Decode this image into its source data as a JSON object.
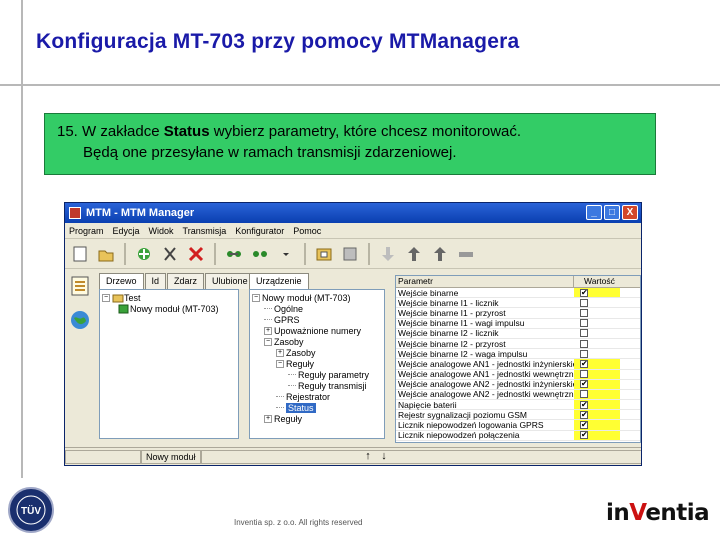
{
  "slide": {
    "title": "Konfiguracja MT-703 przy pomocy MTManagera",
    "instruction_line1_prefix": "15. W zakładce ",
    "instruction_line1_bold": "Status",
    "instruction_line1_suffix": " wybierz parametry, które chcesz monitorować.",
    "instruction_line2": "Będą one przesyłane w ramach transmisji zdarzeniowej.",
    "footer": "Inventia sp. z o.o. All rights reserved"
  },
  "window": {
    "title": "MTM - MTM Manager",
    "buttons": {
      "minimize": "_",
      "maximize": "□",
      "close": "X"
    },
    "menu": [
      "Program",
      "Edycja",
      "Widok",
      "Transmisja",
      "Konfigurator",
      "Pomoc"
    ]
  },
  "left_tabs": [
    "Drzewo",
    "Id",
    "Zdarz",
    "Ulubione"
  ],
  "left_tree": [
    {
      "label": "Test",
      "level": 0,
      "prefix": "−"
    },
    {
      "label": "Nowy moduł (MT-703)",
      "level": 1,
      "prefix": ""
    }
  ],
  "right_tab": "Urządzenie",
  "device_tree": [
    {
      "label": "Nowy moduł (MT-703)",
      "level": 0,
      "prefix": "−",
      "selected": false
    },
    {
      "label": "Ogólne",
      "level": 1,
      "prefix": "",
      "selected": false
    },
    {
      "label": "GPRS",
      "level": 1,
      "prefix": "",
      "selected": false
    },
    {
      "label": "Upoważnione numery",
      "level": 1,
      "prefix": "+",
      "selected": false
    },
    {
      "label": "Zasoby",
      "level": 1,
      "prefix": "−",
      "selected": false
    },
    {
      "label": "Zasoby",
      "level": 2,
      "prefix": "+",
      "selected": false
    },
    {
      "label": "Reguły",
      "level": 2,
      "prefix": "−",
      "selected": false
    },
    {
      "label": "Reguły parametry",
      "level": 3,
      "prefix": "",
      "selected": false
    },
    {
      "label": "Reguły transmisji",
      "level": 3,
      "prefix": "",
      "selected": false
    },
    {
      "label": "Rejestrator",
      "level": 2,
      "prefix": "",
      "selected": false
    },
    {
      "label": "Status",
      "level": 2,
      "prefix": "",
      "selected": true
    },
    {
      "label": "Reguły",
      "level": 1,
      "prefix": "+",
      "selected": false
    }
  ],
  "grid": {
    "headers": [
      "Parametr",
      "Wartość"
    ],
    "rows": [
      {
        "name": "Wejście binarne",
        "checked": true,
        "highlight": true
      },
      {
        "name": "Wejście binarne I1 - licznik",
        "checked": false,
        "highlight": false
      },
      {
        "name": "Wejście binarne I1 - przyrost",
        "checked": false,
        "highlight": false
      },
      {
        "name": "Wejście binarne I1 - wagi impulsu",
        "checked": false,
        "highlight": false
      },
      {
        "name": "Wejście binarne I2 - licznik",
        "checked": false,
        "highlight": false
      },
      {
        "name": "Wejście binarne I2 - przyrost",
        "checked": false,
        "highlight": false
      },
      {
        "name": "Wejście binarne I2 - waga impulsu",
        "checked": false,
        "highlight": false
      },
      {
        "name": "Wejście analogowe AN1 - jednostki inżynierskie",
        "checked": true,
        "highlight": true
      },
      {
        "name": "Wejście analogowe AN1 - jednostki wewnętrzne",
        "checked": false,
        "highlight": true
      },
      {
        "name": "Wejście analogowe AN2 - jednostki inżynierskie",
        "checked": true,
        "highlight": true
      },
      {
        "name": "Wejście analogowe AN2 - jednostki wewnętrzne",
        "checked": false,
        "highlight": true
      },
      {
        "name": "Napięcie baterii",
        "checked": true,
        "highlight": true
      },
      {
        "name": "Rejestr sygnalizacji poziomu GSM",
        "checked": true,
        "highlight": true
      },
      {
        "name": "Licznik niepowodzeń logowania GPRS",
        "checked": true,
        "highlight": true
      },
      {
        "name": "Licznik niepowodzeń połączenia",
        "checked": true,
        "highlight": true
      }
    ]
  },
  "status": {
    "module": "Nowy moduł"
  },
  "brand": {
    "logo_left": "in",
    "logo_red": "V",
    "logo_right": "entia",
    "tuv": "TÜV"
  }
}
